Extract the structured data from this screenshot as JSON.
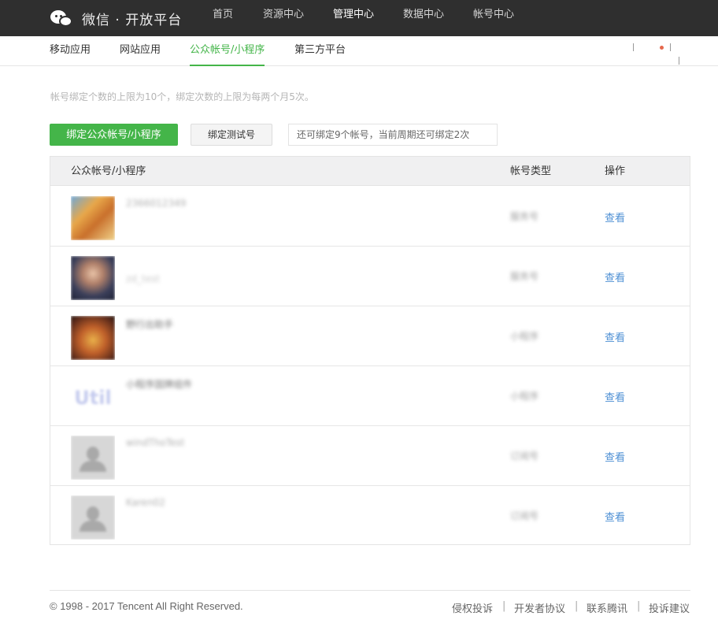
{
  "brand": {
    "title": "微信 · 开放平台"
  },
  "topnav": [
    {
      "label": "首页",
      "active": false
    },
    {
      "label": "资源中心",
      "active": false
    },
    {
      "label": "管理中心",
      "active": true
    },
    {
      "label": "数据中心",
      "active": false
    },
    {
      "label": "帐号中心",
      "active": false
    }
  ],
  "subnav": [
    {
      "label": "移动应用",
      "active": false
    },
    {
      "label": "网站应用",
      "active": false
    },
    {
      "label": "公众帐号/小程序",
      "active": true
    },
    {
      "label": "第三方平台",
      "active": false
    }
  ],
  "notice": "帐号绑定个数的上限为10个，绑定次数的上限为每两个月5次。",
  "buttons": {
    "bind_official": "绑定公众帐号/小程序",
    "bind_test": "绑定测试号"
  },
  "tip": "还可绑定9个帐号，当前周期还可绑定2次",
  "table": {
    "headers": {
      "account": "公众帐号/小程序",
      "type": "帐号类型",
      "action": "操作"
    },
    "rows": [
      {
        "name": "2366012349",
        "type": "服务号",
        "action": "查看",
        "avatar": "photo-orange"
      },
      {
        "name": "zd_test",
        "type": "服务号",
        "action": "查看",
        "avatar": "photo-portrait"
      },
      {
        "name": "野行出助手",
        "type": "小程序",
        "action": "查看",
        "avatar": "photo-food"
      },
      {
        "name": "小程序固牌组件",
        "type": "小程序",
        "action": "查看",
        "avatar": "util-logo",
        "avatar_text": "Util"
      },
      {
        "name": "windThoTest",
        "type": "订阅号",
        "action": "查看",
        "avatar": "default-user"
      },
      {
        "name": "Karen02",
        "type": "订阅号",
        "action": "查看",
        "avatar": "default-user"
      }
    ]
  },
  "footer": {
    "copyright": "© 1998 - 2017 Tencent All Right Reserved.",
    "links": [
      "侵权投诉",
      "开发者协议",
      "联系腾讯",
      "投诉建议"
    ]
  },
  "colors": {
    "accent": "#44b549",
    "link": "#4d8fd4",
    "topbar": "#2f2f2f"
  }
}
